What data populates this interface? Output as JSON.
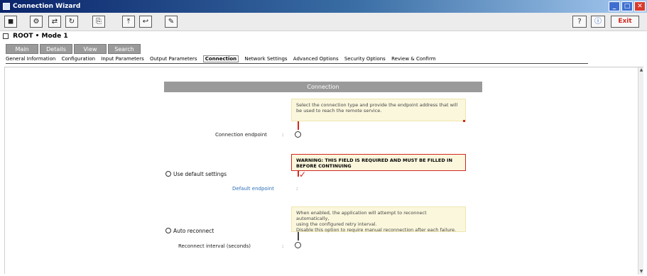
{
  "window": {
    "title": "Connection Wizard"
  },
  "toolbar": {
    "buttons": [
      "◼",
      "⚙",
      "⇄",
      "↻",
      "⎘",
      "⤒",
      "↩",
      "✎"
    ],
    "exit_label": "Exit"
  },
  "crumb": {
    "label": "ROOT • Mode 1"
  },
  "tabs": [
    {
      "label": "Main"
    },
    {
      "label": "Details"
    },
    {
      "label": "View"
    },
    {
      "label": "Search"
    }
  ],
  "breadcrumbs": [
    {
      "label": "General Information"
    },
    {
      "label": "Configuration"
    },
    {
      "label": "Input Parameters"
    },
    {
      "label": "Output Parameters"
    },
    {
      "label": "Connection",
      "current": true
    },
    {
      "label": "Network Settings"
    },
    {
      "label": "Advanced Options"
    },
    {
      "label": "Security Options"
    },
    {
      "label": "Review & Confirm"
    }
  ],
  "main": {
    "section_title": "Connection",
    "note1": "Select the connection type and provide the endpoint address that will be used to reach the remote service.",
    "field1_label": "Connection endpoint",
    "note2": "WARNING: THIS FIELD IS REQUIRED AND MUST BE FILLED IN BEFORE CONTINUING",
    "radio1_label": "Use default settings",
    "field2_label": "Default endpoint",
    "note3_line1": "When enabled, the application will attempt to reconnect automatically,",
    "note3_line2": "using the configured retry interval.",
    "note3_line3": "Disable this option to require manual reconnection after each failure.",
    "radio2_label": "Auto reconnect",
    "field3_label": "Reconnect interval (seconds)"
  }
}
